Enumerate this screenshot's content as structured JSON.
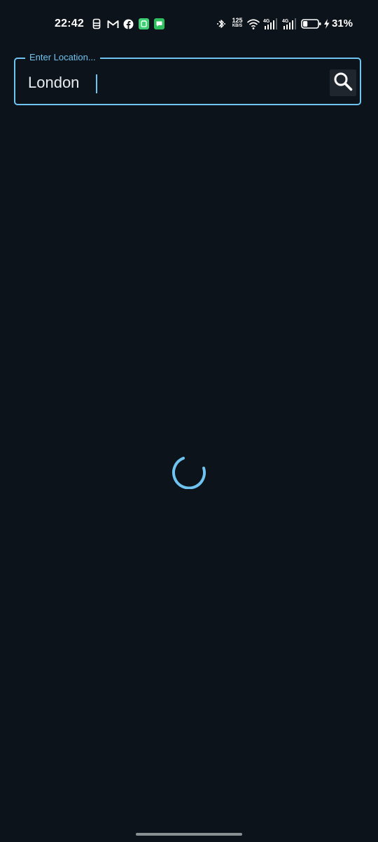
{
  "status_bar": {
    "time": "22:42",
    "notification_icons": [
      "sim-icon",
      "gmail-icon",
      "facebook-icon",
      "android-app-icon",
      "messages-icon"
    ],
    "system_icons": [
      "bluetooth-icon",
      "network-speed",
      "wifi-icon",
      "signal-4g-icon-1",
      "signal-4g-icon-2",
      "battery-icon",
      "charging-icon"
    ],
    "network_speed_value": "125",
    "network_speed_unit": "KB/S",
    "network_type_1": "4G",
    "network_type_2": "4G",
    "battery_percent": "31%",
    "battery_level": 0.31
  },
  "search": {
    "label": "Enter Location...",
    "value": "London",
    "accent_color": "#6fc3f0"
  },
  "loading": {
    "spinner_color": "#6fc3f0"
  },
  "theme": {
    "background": "#0d131a"
  }
}
